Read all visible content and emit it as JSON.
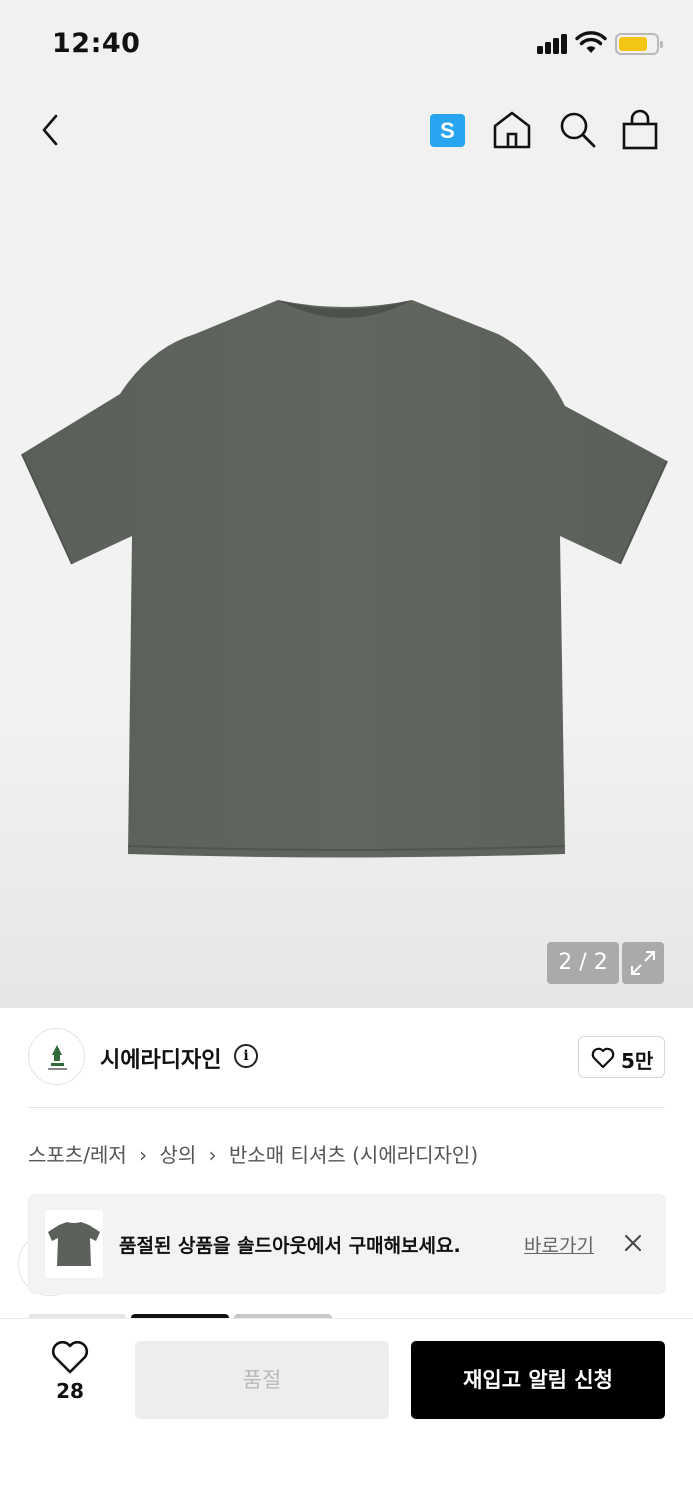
{
  "status_bar": {
    "time": "12:40",
    "battery_color": "#f3c514"
  },
  "nav": {
    "s_badge": "S",
    "s_badge_color": "#27a5f0",
    "icons": [
      "back-icon",
      "home-icon",
      "search-icon",
      "shopping-bag-icon"
    ]
  },
  "gallery": {
    "counter": "2 / 2",
    "product_color": "#5f645e",
    "expand_icon": "expand-icon"
  },
  "brand": {
    "name": "시에라디자인",
    "info_icon": "i",
    "likes": "5만"
  },
  "breadcrumb": [
    "스포츠/레저",
    "상의",
    "반소매 티셔츠 (시에라디자인)"
  ],
  "toast": {
    "message": "품절된 상품을 솔드아웃에서 구매해보세요.",
    "link": "바로가기"
  },
  "bottom_bar": {
    "wish_count": "28",
    "soldout_label": "품절",
    "restock_label": "재입고 알림 신청"
  }
}
